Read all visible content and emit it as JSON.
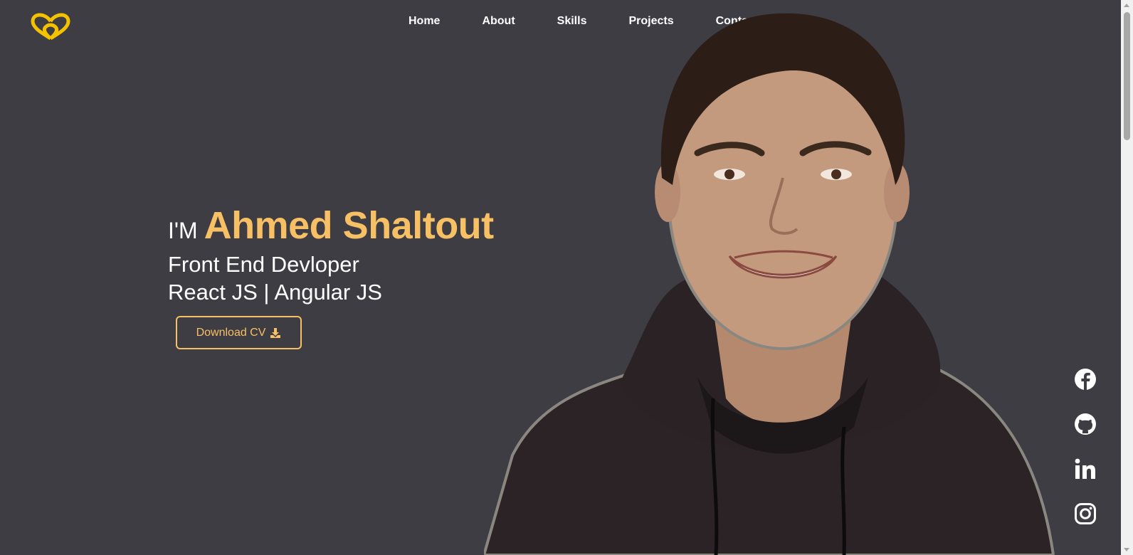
{
  "logo": {
    "icon": "infinity-heart-logo-icon",
    "color": "#f5c200"
  },
  "nav": {
    "items": [
      {
        "label": "Home"
      },
      {
        "label": "About"
      },
      {
        "label": "Skills"
      },
      {
        "label": "Projects"
      },
      {
        "label": "Contact Me"
      }
    ]
  },
  "hero": {
    "intro": "I'M",
    "name": "Ahmed Shaltout",
    "role": "Front End Devloper",
    "tech": "React JS | Angular JS",
    "cv_button": "Download CV",
    "cv_icon": "download-icon"
  },
  "portrait": {
    "icon": "portrait-photo"
  },
  "social": [
    {
      "icon": "facebook-icon"
    },
    {
      "icon": "github-icon"
    },
    {
      "icon": "linkedin-icon"
    },
    {
      "icon": "instagram-icon"
    }
  ],
  "colors": {
    "background": "#3e3d44",
    "accent": "#f7c064",
    "text": "#ffffff"
  }
}
